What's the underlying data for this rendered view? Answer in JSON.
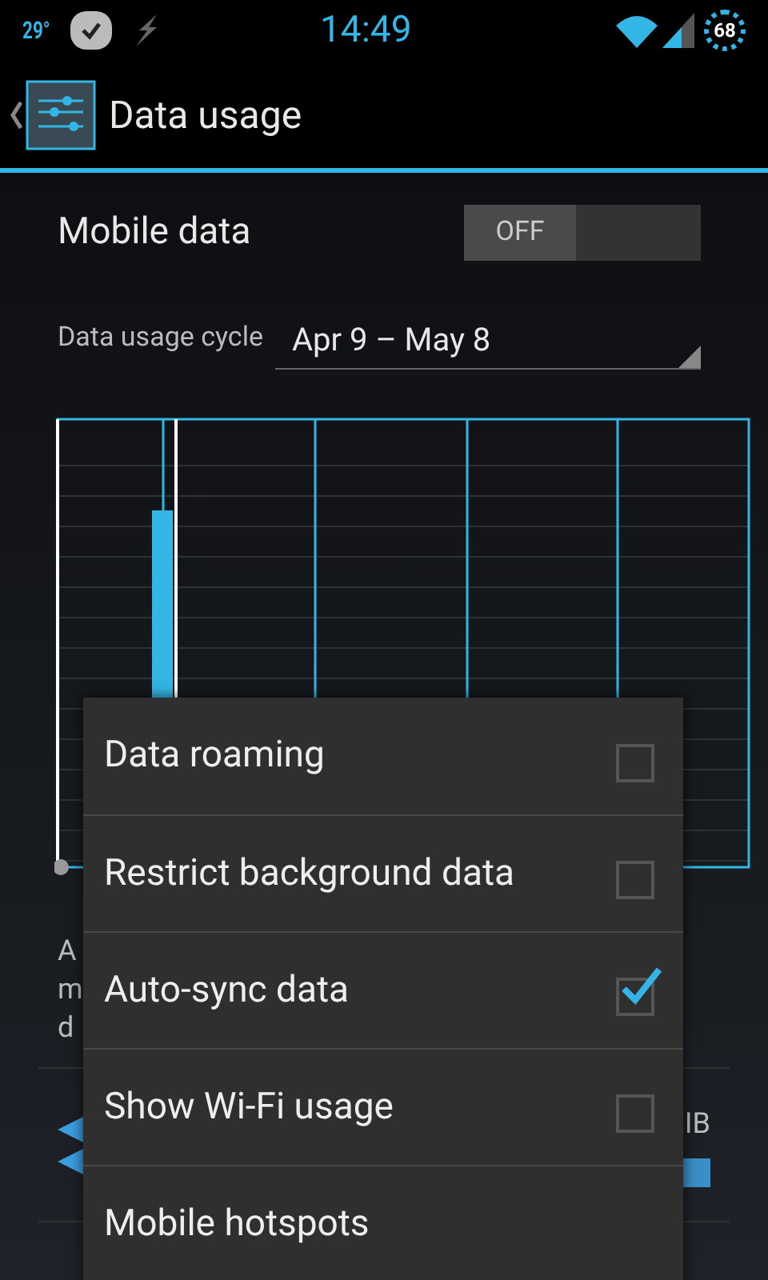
{
  "status_bar": {
    "temperature": "29°",
    "time": "14:49",
    "battery": "68"
  },
  "action_bar": {
    "title": "Data usage"
  },
  "mobile_data": {
    "label": "Mobile data",
    "toggle": "OFF",
    "on": false
  },
  "cycle": {
    "label": "Data usage cycle",
    "value": "Apr 9 – May 8"
  },
  "note_lines": [
    "A",
    "m",
    "d"
  ],
  "app_row": {
    "usage": "IB",
    "level": 1
  },
  "menu": [
    {
      "label": "Data roaming",
      "kind": "checkbox",
      "checked": false
    },
    {
      "label": "Restrict background data",
      "kind": "checkbox",
      "checked": false
    },
    {
      "label": "Auto-sync data",
      "kind": "checkbox",
      "checked": true
    },
    {
      "label": "Show Wi-Fi usage",
      "kind": "checkbox",
      "checked": false
    },
    {
      "label": "Mobile hotspots",
      "kind": "plain"
    }
  ]
}
